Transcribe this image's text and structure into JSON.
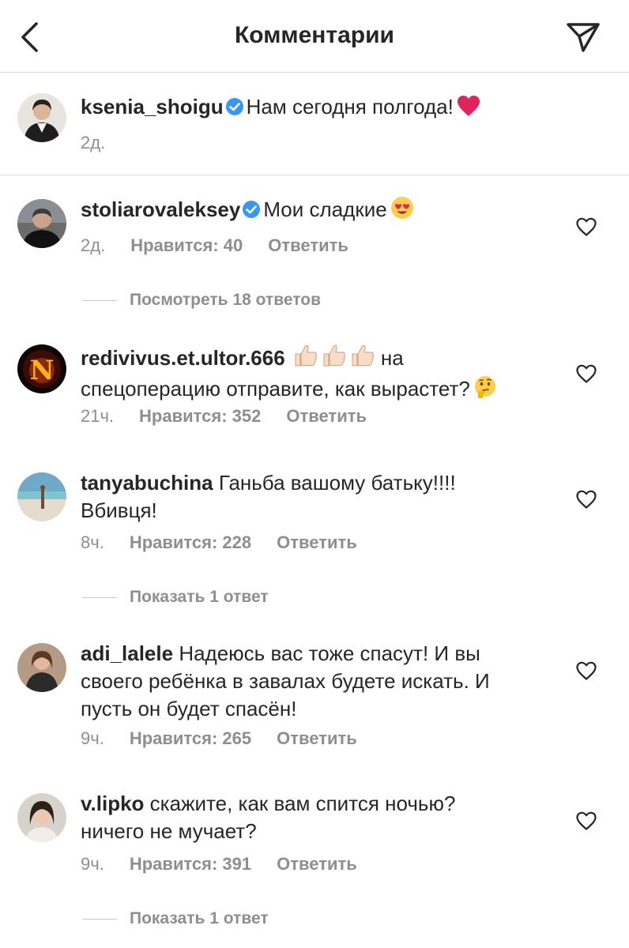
{
  "header": {
    "title": "Комментарии",
    "back_icon": "chevron-left-icon",
    "share_icon": "paper-plane-icon"
  },
  "caption": {
    "username": "ksenia_shoigu",
    "verified": true,
    "text": "Нам сегодня полгода!",
    "emoji": "red-heart",
    "time": "2д."
  },
  "comments": [
    {
      "username": "stoliarovaleksey",
      "verified": true,
      "text": "Мои сладкие",
      "emoji": "heart-eyes",
      "time": "2д.",
      "likes": "Нравится: 40",
      "reply": "Ответить",
      "view_replies": "Посмотреть 18 ответов"
    },
    {
      "username": "redivivus.et.ultor.666",
      "verified": false,
      "text_line1": "на",
      "text_line2": "спецоперацию отправите, как вырастет?",
      "emoji_mid": "thumbs-up-x3",
      "emoji_end": "thinking-face",
      "time": "21ч.",
      "likes": "Нравится: 352",
      "reply": "Ответить"
    },
    {
      "username": "tanyabuchina",
      "verified": false,
      "text_line1": "Ганьба вашому батьку!!!!",
      "text_line2": "Вбивця!",
      "time": "8ч.",
      "likes": "Нравится: 228",
      "reply": "Ответить",
      "view_replies": "Показать 1 ответ"
    },
    {
      "username": "adi_lalele",
      "verified": false,
      "text_line1": "Надеюсь вас тоже спасут! И вы",
      "text_line2": "своего ребёнка в завалах будете искать. И",
      "text_line3": "пусть он будет спасён!",
      "time": "9ч.",
      "likes": "Нравится: 265",
      "reply": "Ответить"
    },
    {
      "username": "v.lipko",
      "verified": false,
      "text_line1": "скажите, как вам спится ночью?",
      "text_line2": "ничего не мучает?",
      "time": "9ч.",
      "likes": "Нравится: 391",
      "reply": "Ответить",
      "view_replies": "Показать 1 ответ"
    }
  ],
  "colors": {
    "text": "#262626",
    "secondary": "#8e8e8e",
    "verified": "#3897f0",
    "divider": "#dbdbdb",
    "heart": "#e0245e"
  }
}
